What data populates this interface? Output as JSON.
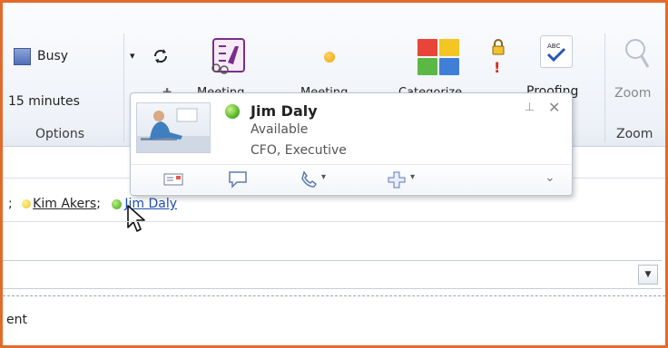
{
  "ribbon": {
    "presence_label": "Busy",
    "reminder_value": "15 minutes",
    "options_group": "Options",
    "meeting_label_1": "Meeting",
    "meeting_label_2": "Meeting",
    "categorize_label": "Categorize",
    "proofing_label": "Proofing",
    "zoom_button_label": "Zoom",
    "zoom_group": "Zoom"
  },
  "card": {
    "name": "Jim Daly",
    "status": "Available",
    "title": "CFO, Executive",
    "status_color": "#48ad1f"
  },
  "recipients": {
    "separator": ";",
    "items": [
      {
        "name": "Kim Akers",
        "status": "yellow"
      },
      {
        "name": "Jim Daly",
        "status": "green"
      }
    ]
  },
  "body": {
    "text_fragment": "ent"
  },
  "colors": {
    "frame": "#e26a2c",
    "link": "#1f4fb0"
  }
}
